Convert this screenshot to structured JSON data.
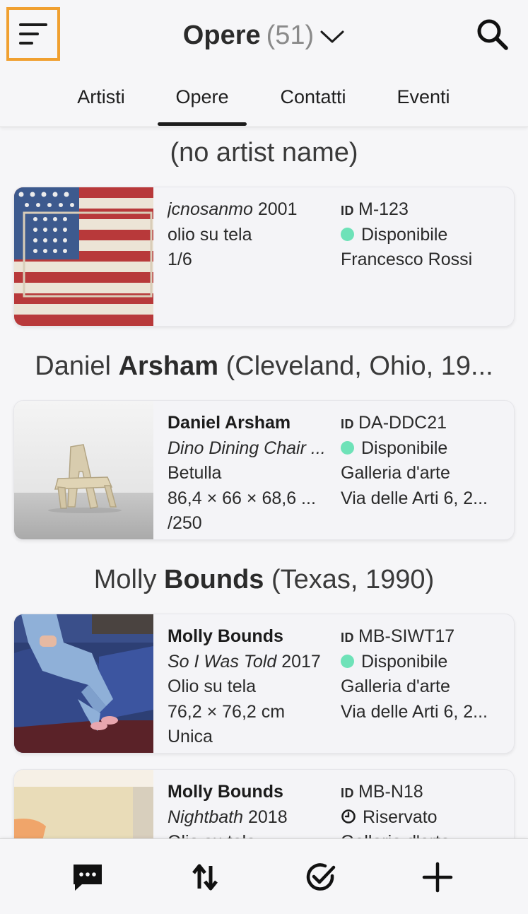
{
  "header": {
    "title": "Opere",
    "count": "(51)"
  },
  "tabs": [
    {
      "label": "Artisti"
    },
    {
      "label": "Opere"
    },
    {
      "label": "Contatti"
    },
    {
      "label": "Eventi"
    }
  ],
  "groups": [
    {
      "title_prefix": "(no artist name)",
      "title_bold": "",
      "title_suffix": "",
      "cards": [
        {
          "artist": "",
          "title_italic": "jcnosanmo",
          "year": "2001",
          "medium": "olio su tela",
          "dimensions": "1/6",
          "edition": "",
          "id_label": "ID",
          "id": "M-123",
          "status": "Disponibile",
          "status_icon": "green-dot",
          "location": "Francesco Rossi",
          "address": ""
        }
      ]
    },
    {
      "title_prefix": "Daniel ",
      "title_bold": "Arsham",
      "title_suffix": " (Cleveland, Ohio, 19...",
      "cards": [
        {
          "artist": "Daniel Arsham",
          "title_italic": "Dino Dining Chair ...",
          "year": "",
          "medium": "Betulla",
          "dimensions": "86,4 × 66 × 68,6 ...",
          "edition": "/250",
          "id_label": "ID",
          "id": "DA-DDC21",
          "status": "Disponibile",
          "status_icon": "green-dot",
          "location": "Galleria d'arte",
          "address": "Via delle Arti 6, 2..."
        }
      ]
    },
    {
      "title_prefix": "Molly ",
      "title_bold": "Bounds",
      "title_suffix": " (Texas, 1990)",
      "cards": [
        {
          "artist": "Molly Bounds",
          "title_italic": "So I Was Told",
          "year": "2017",
          "medium": "Olio su tela",
          "dimensions": "76,2 × 76,2 cm",
          "edition": "Unica",
          "id_label": "ID",
          "id": "MB-SIWT17",
          "status": "Disponibile",
          "status_icon": "green-dot",
          "location": "Galleria d'arte",
          "address": "Via delle Arti 6, 2..."
        },
        {
          "artist": "Molly Bounds",
          "title_italic": "Nightbath",
          "year": "2018",
          "medium": "Olio su tela",
          "dimensions": "",
          "edition": "",
          "id_label": "ID",
          "id": "MB-N18",
          "status": "Riservato",
          "status_icon": "clock-icon",
          "location": "Galleria d'arte",
          "address": ""
        }
      ]
    }
  ],
  "bottom_bar": {
    "icons": [
      "chat-icon",
      "sort-icon",
      "check-circle-icon",
      "plus-icon"
    ]
  },
  "colors": {
    "accent_highlight": "#f0a030",
    "status_available": "#6ee2b8",
    "background": "#f6f6f8"
  }
}
